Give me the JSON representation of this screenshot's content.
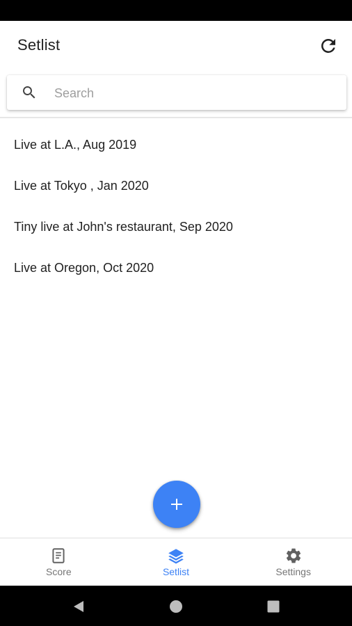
{
  "app_bar": {
    "title": "Setlist",
    "refresh_icon": "refresh-icon"
  },
  "search": {
    "placeholder": "Search",
    "value": "",
    "icon": "search-icon"
  },
  "setlists": [
    "Live at L.A., Aug 2019",
    "Live at Tokyo , Jan 2020",
    "Tiny live at John's restaurant, Sep 2020",
    "Live at Oregon, Oct 2020"
  ],
  "fab": {
    "icon": "plus-icon"
  },
  "bottom_nav": {
    "items": [
      {
        "label": "Score",
        "icon": "score-icon",
        "active": false
      },
      {
        "label": "Setlist",
        "icon": "layers-icon",
        "active": true
      },
      {
        "label": "Settings",
        "icon": "gear-icon",
        "active": false
      }
    ]
  },
  "colors": {
    "accent": "#3d82f5",
    "text": "#212121",
    "inactive": "#757575",
    "placeholder": "#9e9e9e"
  },
  "system_nav": {
    "buttons": [
      "back-icon",
      "home-icon",
      "recents-icon"
    ]
  }
}
